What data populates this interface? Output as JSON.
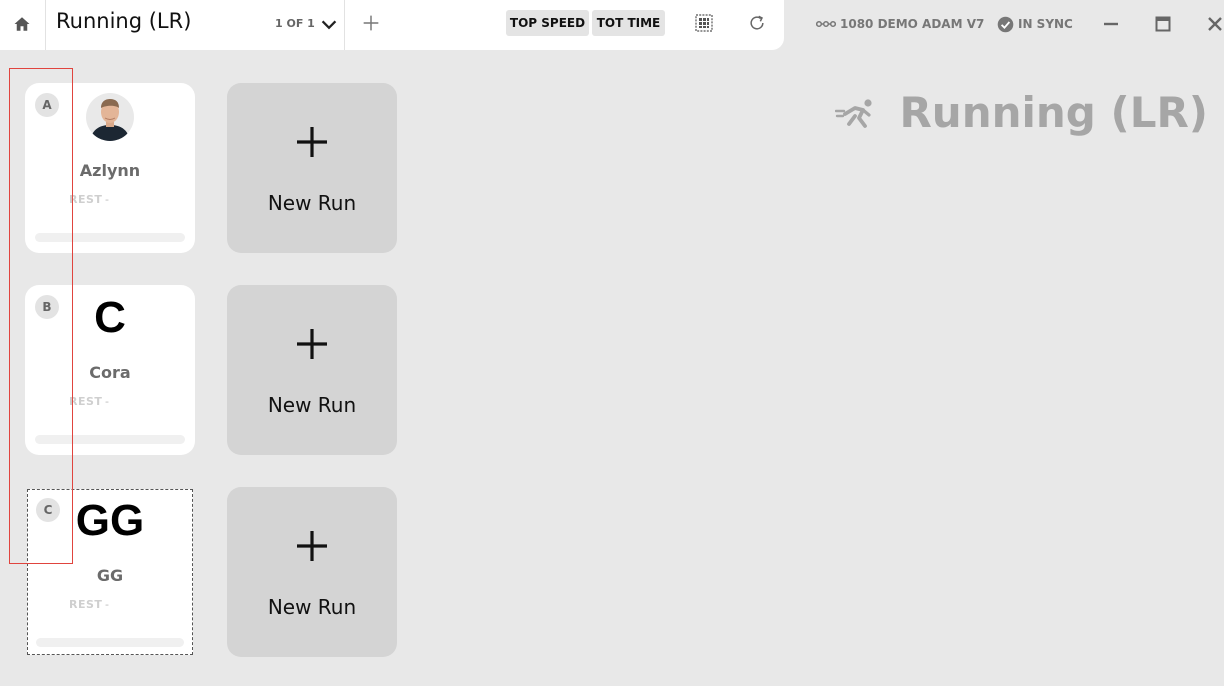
{
  "topbar": {
    "title": "Running (LR)",
    "page_count": "1 OF 1",
    "metric_buttons": [
      "TOP SPEED",
      "TOT TIME"
    ],
    "device": "1080 DEMO ADAM V7",
    "sync_status": "IN SYNC"
  },
  "activity": {
    "title": "Running (LR)"
  },
  "athletes": [
    {
      "slot": "A",
      "name": "Azlynn",
      "avatar": "photo",
      "initials": "",
      "rest_label": "REST",
      "rest_value": "-",
      "progress": 0
    },
    {
      "slot": "B",
      "name": "Cora",
      "avatar": "initials",
      "initials": "C",
      "rest_label": "REST",
      "rest_value": "-",
      "progress": 0
    },
    {
      "slot": "C",
      "name": "GG",
      "avatar": "initials",
      "initials": "GG",
      "rest_label": "REST",
      "rest_value": "-",
      "progress": 0
    }
  ],
  "new_run": {
    "label": "New Run"
  },
  "colors": {
    "accent_highlight": "#e0443e",
    "new_run_bg": "#d4d4d4",
    "app_bg": "#e8e8e8"
  }
}
